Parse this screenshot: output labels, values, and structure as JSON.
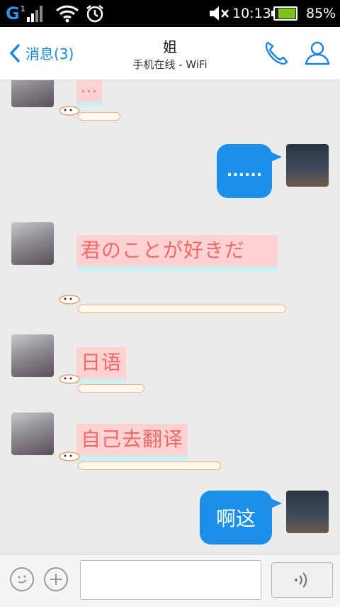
{
  "status_bar": {
    "network": "G",
    "sim_slot": "1",
    "time": "10:13",
    "battery": "85%",
    "battery_level": 0.85
  },
  "header": {
    "back_label": "消息(3)",
    "title": "姐",
    "subtitle": "手机在线 - WiFi"
  },
  "messages": [
    {
      "from": "contact",
      "text": "..."
    },
    {
      "from": "me",
      "text": "......"
    },
    {
      "from": "contact",
      "text": "君のことが好きだ"
    },
    {
      "from": "contact",
      "text": "日语"
    },
    {
      "from": "contact",
      "text": "自己去翻译"
    },
    {
      "from": "me",
      "text": "啊这"
    }
  ],
  "input": {
    "placeholder": ""
  },
  "colors": {
    "accent": "#1a86d8",
    "bubble_out": "#1e8fe8",
    "bubble_in": "#ffd2d2",
    "bubble_in_text": "#ee6a6a"
  },
  "icons": [
    "signal-icon",
    "wifi-icon",
    "alarm-icon",
    "mute-icon",
    "battery-icon",
    "back-chevron-icon",
    "phone-icon",
    "profile-icon",
    "emoji-icon",
    "plus-icon",
    "voice-icon"
  ]
}
